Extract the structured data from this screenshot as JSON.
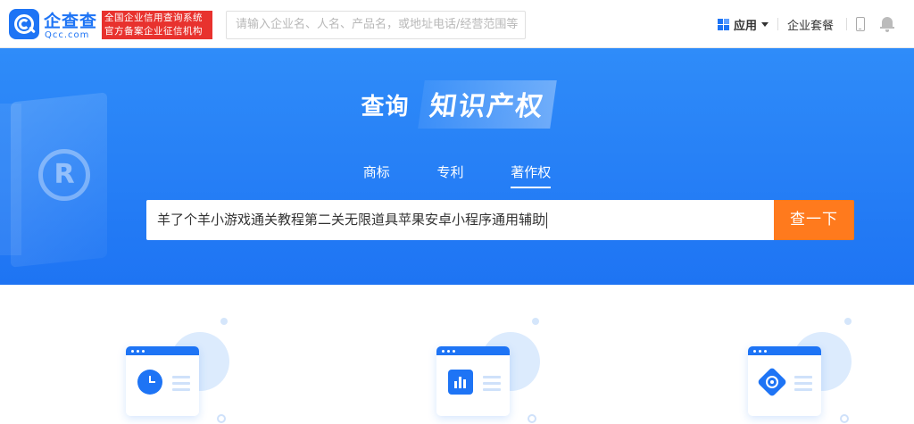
{
  "header": {
    "logo_cn": "企查查",
    "logo_en": "Qcc.com",
    "badge_line1": "全国企业信用查询系统",
    "badge_line2": "官方备案企业征信机构",
    "search_placeholder": "请输入企业名、人名、产品名，或地址电话/经营范围等",
    "apps_label": "应用",
    "plan_label": "企业套餐"
  },
  "hero": {
    "title_prefix": "查询",
    "title_main": "知识产权",
    "tabs": [
      {
        "label": "商标",
        "active": false
      },
      {
        "label": "专利",
        "active": false
      },
      {
        "label": "著作权",
        "active": true
      }
    ],
    "search_value": "羊了个羊小游戏通关教程第二关无限道具苹果安卓小程序通用辅助",
    "search_button": "查一下",
    "deco_symbol": "R"
  },
  "colors": {
    "brand_blue": "#1e74f5",
    "badge_red": "#e8322e",
    "search_orange": "#ff7a1d"
  },
  "features": [
    {
      "icon": "clock-icon"
    },
    {
      "icon": "bar-chart-icon"
    },
    {
      "icon": "target-icon"
    }
  ]
}
